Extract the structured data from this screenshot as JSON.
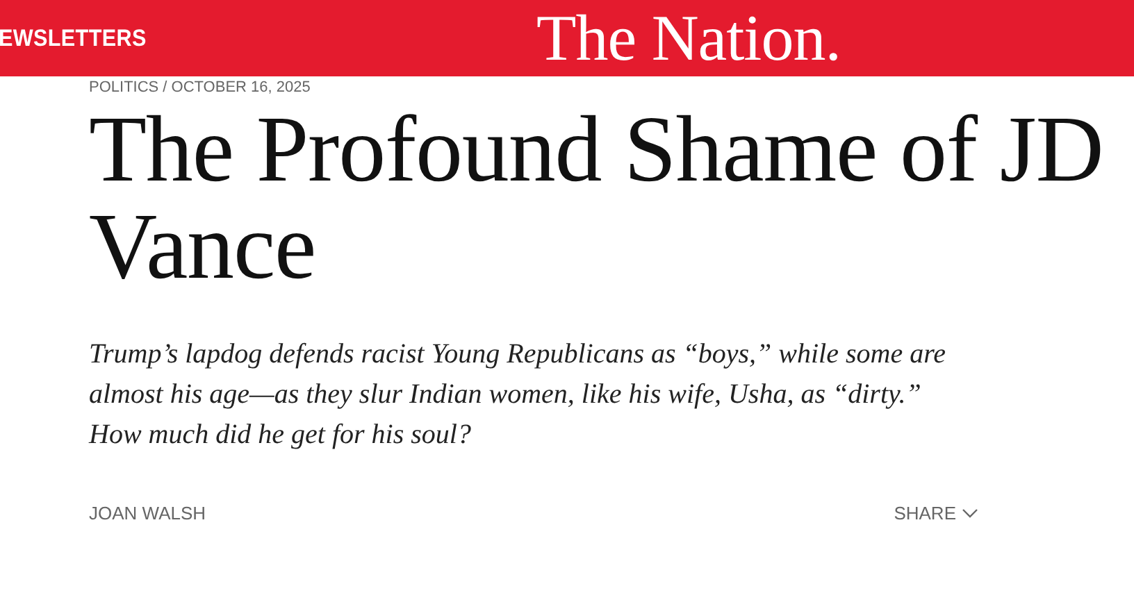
{
  "header": {
    "nav_link": "EWSLETTERS",
    "logo": "The Nation."
  },
  "article": {
    "dateline": "POLITICS / OCTOBER 16, 2025",
    "headline": "The Profound Shame of JD Vance",
    "dek": "Trump’s lapdog defends racist Young Republicans as “boys,” while some are almost his age—as they slur Indian women, like his wife, Usha, as “dirty.” How much did he get for his soul?",
    "author": "JOAN WALSH",
    "share": "SHARE"
  }
}
